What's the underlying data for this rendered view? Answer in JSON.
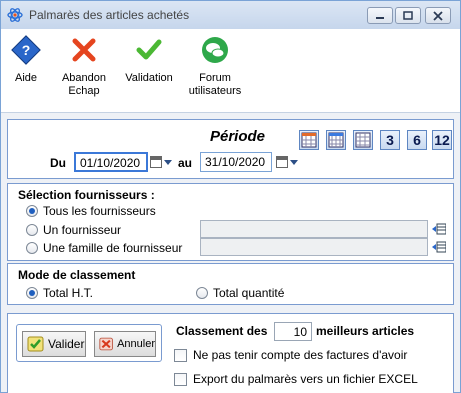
{
  "window": {
    "title": "Palmarès des articles achetés"
  },
  "toolbar": {
    "aide": "Aide",
    "abandon": "Abandon",
    "abandon_sub": "Echap",
    "validation": "Validation",
    "forum": "Forum",
    "forum_sub": "utilisateurs"
  },
  "periode": {
    "title": "Période",
    "du_label": "Du",
    "du_value": "01/10/2020",
    "au_label": "au",
    "au_value": "31/10/2020",
    "quick_buttons": [
      "3",
      "6",
      "12"
    ]
  },
  "fournisseurs": {
    "title": "Sélection fournisseurs :",
    "options": [
      "Tous les fournisseurs",
      "Un fournisseur",
      "Une famille de fournisseur"
    ],
    "selected": 0
  },
  "classement": {
    "title": "Mode de classement",
    "options": [
      "Total H.T.",
      "Total quantité"
    ],
    "selected": 0
  },
  "bottom": {
    "valider": "Valider",
    "annuler": "Annuler",
    "classement_label": "Classement des",
    "classement_value": "10",
    "classement_suffix": "meilleurs articles",
    "check_avoir": "Ne pas tenir compte des factures d'avoir",
    "check_excel": "Export du palmarès vers un fichier EXCEL"
  },
  "colors": {
    "accent": "#1f5fbf",
    "group_border": "#7a9bd0",
    "title_bg": "#c6d6ec"
  }
}
